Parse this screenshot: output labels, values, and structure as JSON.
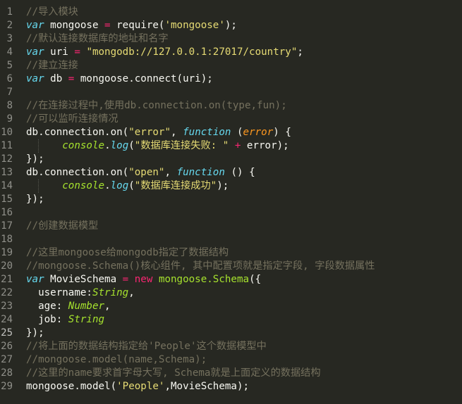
{
  "editor": {
    "language": "javascript",
    "theme": "monokai",
    "colors": {
      "background": "#272822",
      "line_number": "#90908a",
      "comment": "#75715e",
      "keyword": "#66d9ef",
      "string": "#e6db74",
      "operator": "#f92672",
      "builtin": "#a6e22e",
      "param": "#fd971f",
      "plain": "#f8f8f2"
    },
    "active_line": 25,
    "lines": [
      {
        "n": "1",
        "indent": 0,
        "tokens": [
          {
            "t": "comment",
            "v": "//导入模块"
          }
        ]
      },
      {
        "n": "2",
        "indent": 0,
        "tokens": [
          {
            "t": "keyword",
            "v": "var"
          },
          {
            "t": "plain",
            "v": " mongoose "
          },
          {
            "t": "operator",
            "v": "="
          },
          {
            "t": "plain",
            "v": " require("
          },
          {
            "t": "string",
            "v": "'mongoose'"
          },
          {
            "t": "plain",
            "v": ");"
          }
        ]
      },
      {
        "n": "3",
        "indent": 0,
        "tokens": [
          {
            "t": "comment",
            "v": "//默认连接数据库的地址和名字"
          }
        ]
      },
      {
        "n": "4",
        "indent": 0,
        "tokens": [
          {
            "t": "keyword",
            "v": "var"
          },
          {
            "t": "plain",
            "v": " uri "
          },
          {
            "t": "operator",
            "v": "="
          },
          {
            "t": "plain",
            "v": " "
          },
          {
            "t": "string",
            "v": "\"mongodb://127.0.0.1:27017/country\""
          },
          {
            "t": "plain",
            "v": ";"
          }
        ]
      },
      {
        "n": "5",
        "indent": 0,
        "tokens": [
          {
            "t": "comment",
            "v": "//建立连接"
          }
        ]
      },
      {
        "n": "6",
        "indent": 0,
        "tokens": [
          {
            "t": "keyword",
            "v": "var"
          },
          {
            "t": "plain",
            "v": " db "
          },
          {
            "t": "operator",
            "v": "="
          },
          {
            "t": "plain",
            "v": " mongoose.connect(uri);"
          }
        ]
      },
      {
        "n": "7",
        "indent": 0,
        "tokens": []
      },
      {
        "n": "8",
        "indent": 0,
        "tokens": [
          {
            "t": "comment",
            "v": "//在连接过程中,使用db.connection.on(type,fun);"
          }
        ]
      },
      {
        "n": "9",
        "indent": 0,
        "tokens": [
          {
            "t": "comment",
            "v": "//可以监听连接情况"
          }
        ]
      },
      {
        "n": "10",
        "indent": 0,
        "tokens": [
          {
            "t": "plain",
            "v": "db.connection.on("
          },
          {
            "t": "string",
            "v": "\"error\""
          },
          {
            "t": "plain",
            "v": ", "
          },
          {
            "t": "keyword",
            "v": "function"
          },
          {
            "t": "plain",
            "v": " ("
          },
          {
            "t": "param",
            "v": "error"
          },
          {
            "t": "plain",
            "v": ") {"
          }
        ]
      },
      {
        "n": "11",
        "indent": 1,
        "tokens": [
          {
            "t": "builtin",
            "v": "console"
          },
          {
            "t": "plain",
            "v": "."
          },
          {
            "t": "keyword",
            "v": "log"
          },
          {
            "t": "plain",
            "v": "("
          },
          {
            "t": "string",
            "v": "\"数据库连接失败: \""
          },
          {
            "t": "plain",
            "v": " "
          },
          {
            "t": "operator",
            "v": "+"
          },
          {
            "t": "plain",
            "v": " error);"
          }
        ]
      },
      {
        "n": "12",
        "indent": 0,
        "tokens": [
          {
            "t": "plain",
            "v": "});"
          }
        ]
      },
      {
        "n": "13",
        "indent": 0,
        "tokens": [
          {
            "t": "plain",
            "v": "db.connection.on("
          },
          {
            "t": "string",
            "v": "\"open\""
          },
          {
            "t": "plain",
            "v": ", "
          },
          {
            "t": "keyword",
            "v": "function"
          },
          {
            "t": "plain",
            "v": " () {"
          }
        ]
      },
      {
        "n": "14",
        "indent": 1,
        "tokens": [
          {
            "t": "builtin",
            "v": "console"
          },
          {
            "t": "plain",
            "v": "."
          },
          {
            "t": "keyword",
            "v": "log"
          },
          {
            "t": "plain",
            "v": "("
          },
          {
            "t": "string",
            "v": "\"数据库连接成功\""
          },
          {
            "t": "plain",
            "v": ");"
          }
        ]
      },
      {
        "n": "15",
        "indent": 0,
        "tokens": [
          {
            "t": "plain",
            "v": "});"
          }
        ]
      },
      {
        "n": "16",
        "indent": 0,
        "tokens": []
      },
      {
        "n": "17",
        "indent": 0,
        "tokens": [
          {
            "t": "comment",
            "v": "//创建数据模型"
          }
        ]
      },
      {
        "n": "18",
        "indent": 0,
        "tokens": []
      },
      {
        "n": "19",
        "indent": 0,
        "tokens": [
          {
            "t": "comment",
            "v": "//这里mongoose给mongodb指定了数据结构"
          }
        ]
      },
      {
        "n": "20",
        "indent": 0,
        "tokens": [
          {
            "t": "comment",
            "v": "//mongoose.Schema()核心组件, 其中配置项就是指定字段, 字段数据属性"
          }
        ]
      },
      {
        "n": "21",
        "indent": 0,
        "tokens": [
          {
            "t": "keyword",
            "v": "var"
          },
          {
            "t": "plain",
            "v": " MovieSchema "
          },
          {
            "t": "operator",
            "v": "="
          },
          {
            "t": "plain",
            "v": " "
          },
          {
            "t": "operator",
            "v": "new"
          },
          {
            "t": "plain",
            "v": " "
          },
          {
            "t": "class",
            "v": "mongoose.Schema"
          },
          {
            "t": "plain",
            "v": "({"
          }
        ]
      },
      {
        "n": "22",
        "indent": 0,
        "tokens": [
          {
            "t": "plain",
            "v": "  username:"
          },
          {
            "t": "type",
            "v": "String"
          },
          {
            "t": "plain",
            "v": ","
          }
        ]
      },
      {
        "n": "23",
        "indent": 0,
        "tokens": [
          {
            "t": "plain",
            "v": "  age: "
          },
          {
            "t": "type",
            "v": "Number"
          },
          {
            "t": "plain",
            "v": ","
          }
        ]
      },
      {
        "n": "24",
        "indent": 0,
        "tokens": [
          {
            "t": "plain",
            "v": "  job: "
          },
          {
            "t": "type",
            "v": "String"
          }
        ]
      },
      {
        "n": "25",
        "indent": 0,
        "tokens": [
          {
            "t": "plain",
            "v": "});"
          }
        ]
      },
      {
        "n": "26",
        "indent": 0,
        "tokens": [
          {
            "t": "comment",
            "v": "//将上面的数据结构指定给'People'这个数据模型中"
          }
        ]
      },
      {
        "n": "27",
        "indent": 0,
        "tokens": [
          {
            "t": "comment",
            "v": "//mongoose.model(name,Schema);"
          }
        ]
      },
      {
        "n": "28",
        "indent": 0,
        "tokens": [
          {
            "t": "comment",
            "v": "//这里的name要求首字母大写, Schema就是上面定义的数据结构"
          }
        ]
      },
      {
        "n": "29",
        "indent": 0,
        "tokens": [
          {
            "t": "plain",
            "v": "mongoose.model("
          },
          {
            "t": "string",
            "v": "'People'"
          },
          {
            "t": "plain",
            "v": ",MovieSchema);"
          }
        ]
      }
    ]
  }
}
